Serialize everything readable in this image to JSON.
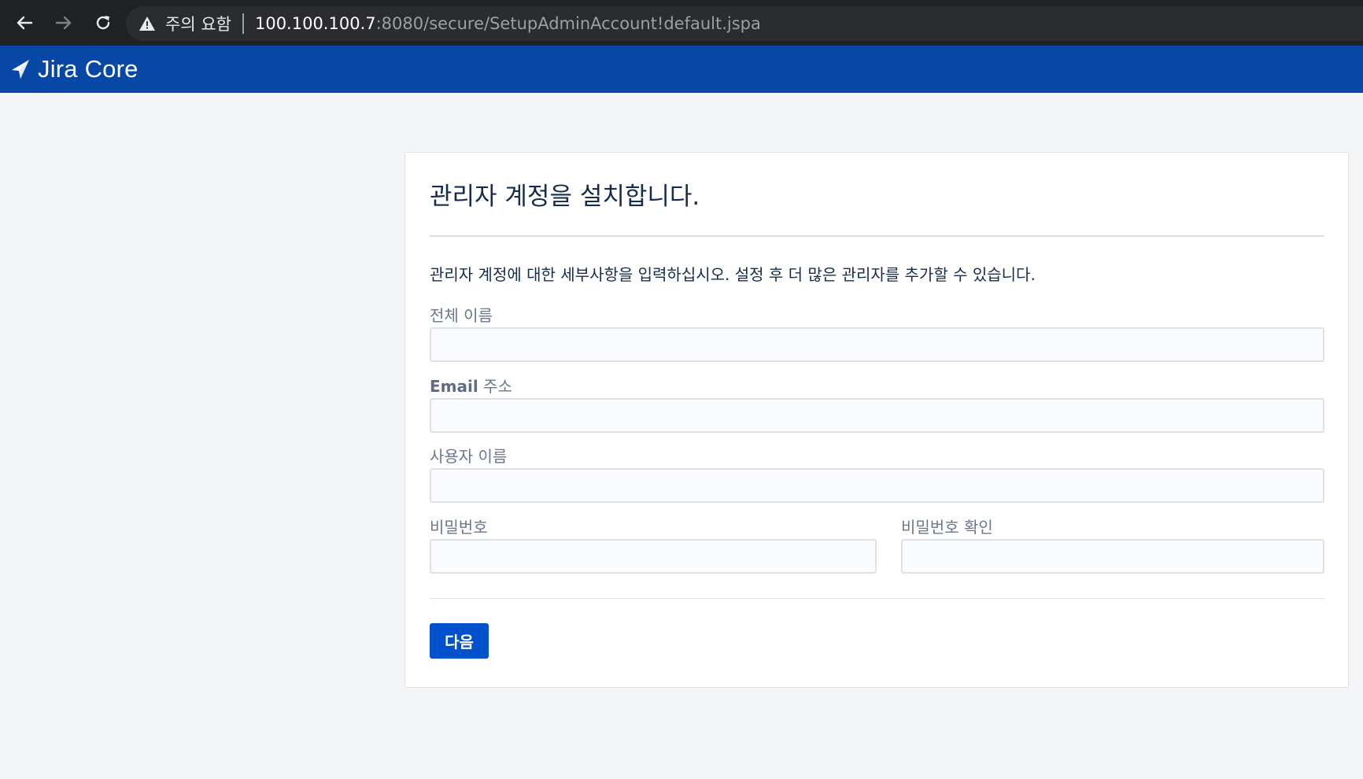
{
  "browser": {
    "back_icon": "arrow-left-icon",
    "forward_icon": "arrow-right-icon",
    "reload_icon": "reload-icon",
    "security_icon": "warning-triangle-icon",
    "security_label": "주의 요함",
    "url_host": "100.100.100.7",
    "url_rest": ":8080/secure/SetupAdminAccount!default.jspa"
  },
  "header": {
    "logo_icon": "jira-logo-icon",
    "title": "Jira Core",
    "background": "#0747a6"
  },
  "form": {
    "title": "관리자 계정을 설치합니다.",
    "intro": "관리자 계정에 대한 세부사항을 입력하십시오. 설정 후 더 많은 관리자를 추가할 수 있습니다.",
    "fields": {
      "full_name": {
        "label": "전체 이름",
        "value": ""
      },
      "email": {
        "label_strong": "Email",
        "label_rest": " 주소",
        "value": ""
      },
      "username": {
        "label": "사용자 이름",
        "value": ""
      },
      "password": {
        "label": "비밀번호",
        "value": ""
      },
      "confirm_password": {
        "label": "비밀번호 확인",
        "value": ""
      }
    },
    "next_button": "다음",
    "accent": "#0052cc"
  }
}
